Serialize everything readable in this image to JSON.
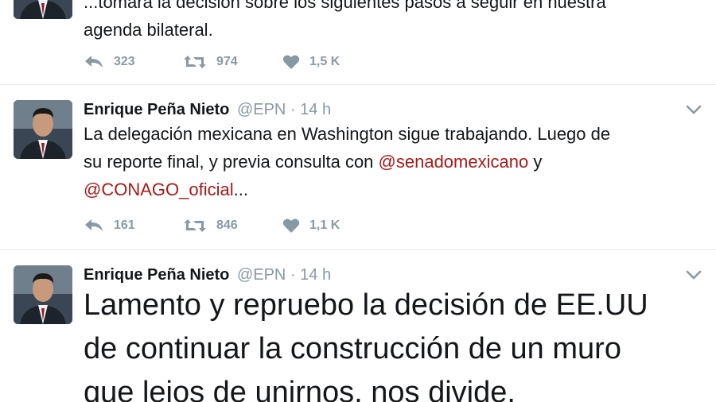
{
  "tweets": [
    {
      "text_lines": [
        "...tomará la decisión sobre los siguientes pasos a seguir en nuestra",
        "agenda bilateral."
      ],
      "replies": "323",
      "retweets": "974",
      "likes": "1,5 K"
    },
    {
      "name": "Enrique Peña Nieto",
      "handle": "@EPN",
      "separator": "·",
      "time": "14 h",
      "text_line1": "La delegación mexicana en Washington sigue trabajando. Luego de",
      "text_line2_pre": "su reporte final, y previa consulta con ",
      "mention1": "@senadomexicano",
      "text_line2_post": " y",
      "mention2": "@CONAGO_oficial",
      "text_line3_post": "...",
      "replies": "161",
      "retweets": "846",
      "likes": "1,1 K"
    },
    {
      "name": "Enrique Peña Nieto",
      "handle": "@EPN",
      "separator": "·",
      "time": "14 h",
      "text_lines": [
        "Lamento y repruebo la decisión de EE.UU",
        "de continuar la construcción de un muro",
        "que lejos de unirnos, nos divide."
      ]
    }
  ],
  "icons": {
    "avatar": "profile-photo",
    "reply": "reply-icon",
    "retweet": "retweet-icon",
    "like": "heart-icon",
    "menu": "chevron-down-icon"
  },
  "colors": {
    "mention": "#a61a1a",
    "meta": "#8899a6",
    "text": "#14171a",
    "divider": "#e1e8ed"
  }
}
